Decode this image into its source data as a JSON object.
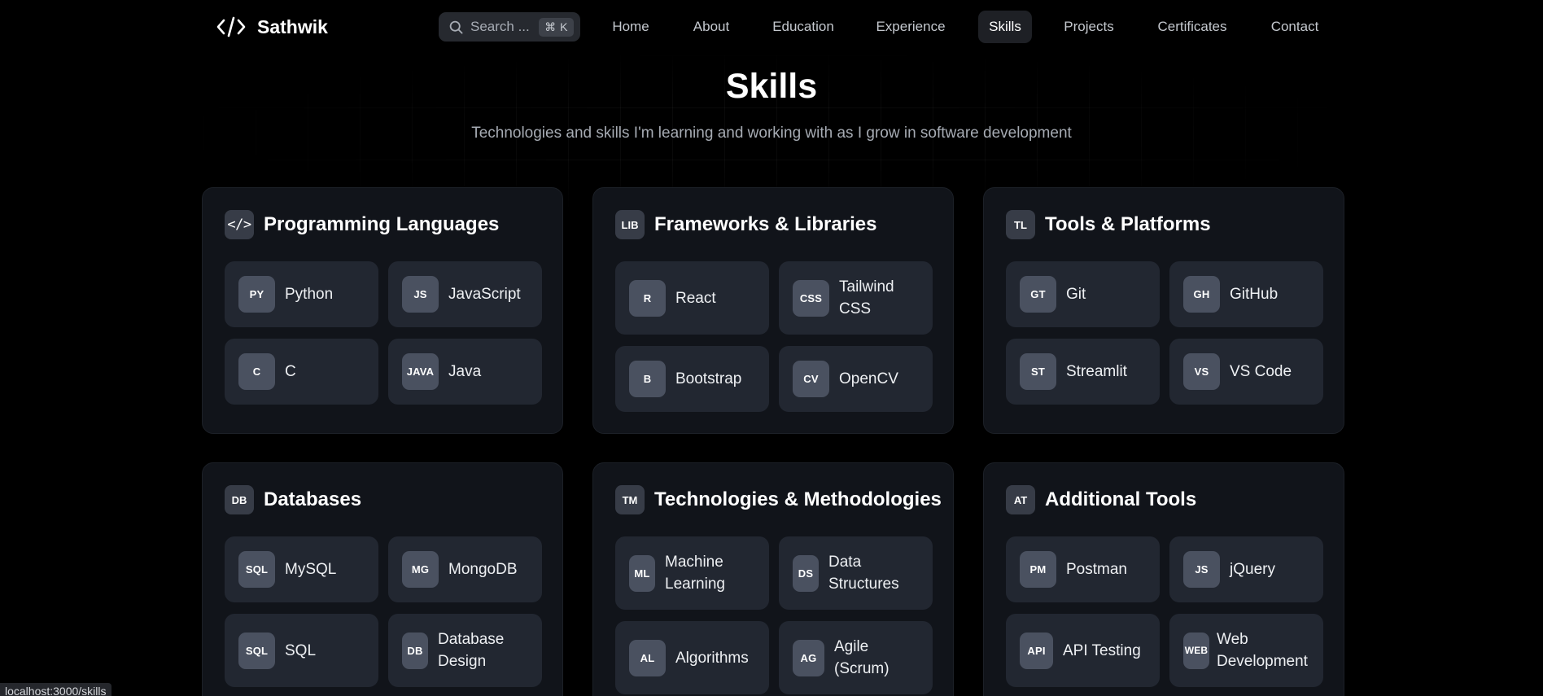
{
  "brand": {
    "icon": "code-brackets-icon",
    "name": "Sathwik"
  },
  "search": {
    "placeholder": "Search ...",
    "shortcut": "⌘ K"
  },
  "nav": {
    "items": [
      {
        "label": "Home"
      },
      {
        "label": "About"
      },
      {
        "label": "Education"
      },
      {
        "label": "Experience"
      },
      {
        "label": "Skills",
        "active": true
      },
      {
        "label": "Projects"
      },
      {
        "label": "Certificates"
      },
      {
        "label": "Contact"
      }
    ]
  },
  "hero": {
    "title": "Skills",
    "subtitle": "Technologies and skills I'm learning and working with as I grow in software development"
  },
  "categories": [
    {
      "icon": "</>",
      "title": "Programming Languages",
      "skills": [
        {
          "badge": "PY",
          "label": "Python"
        },
        {
          "badge": "JS",
          "label": "JavaScript"
        },
        {
          "badge": "C",
          "label": "C"
        },
        {
          "badge": "JAVA",
          "label": "Java"
        }
      ]
    },
    {
      "icon": "LIB",
      "title": "Frameworks & Libraries",
      "skills": [
        {
          "badge": "R",
          "label": "React"
        },
        {
          "badge": "CSS",
          "label": "Tailwind CSS"
        },
        {
          "badge": "B",
          "label": "Bootstrap"
        },
        {
          "badge": "CV",
          "label": "OpenCV"
        }
      ]
    },
    {
      "icon": "TL",
      "title": "Tools & Platforms",
      "skills": [
        {
          "badge": "GT",
          "label": "Git"
        },
        {
          "badge": "GH",
          "label": "GitHub"
        },
        {
          "badge": "ST",
          "label": "Streamlit"
        },
        {
          "badge": "VS",
          "label": "VS Code"
        }
      ]
    },
    {
      "icon": "DB",
      "title": "Databases",
      "skills": [
        {
          "badge": "SQL",
          "label": "MySQL"
        },
        {
          "badge": "MG",
          "label": "MongoDB"
        },
        {
          "badge": "SQL",
          "label": "SQL"
        },
        {
          "badge": "DB",
          "label": "Database Design"
        }
      ]
    },
    {
      "icon": "TM",
      "title": "Technologies & Methodologies",
      "skills": [
        {
          "badge": "ML",
          "label": "Machine Learning"
        },
        {
          "badge": "DS",
          "label": "Data Structures"
        },
        {
          "badge": "AL",
          "label": "Algorithms"
        },
        {
          "badge": "AG",
          "label": "Agile (Scrum)"
        }
      ]
    },
    {
      "icon": "AT",
      "title": "Additional Tools",
      "skills": [
        {
          "badge": "PM",
          "label": "Postman"
        },
        {
          "badge": "JS",
          "label": "jQuery"
        },
        {
          "badge": "API",
          "label": "API Testing"
        },
        {
          "badge": "WEB",
          "label": "Web Development"
        }
      ]
    }
  ],
  "status_bar": {
    "url": "localhost:3000/skills"
  }
}
